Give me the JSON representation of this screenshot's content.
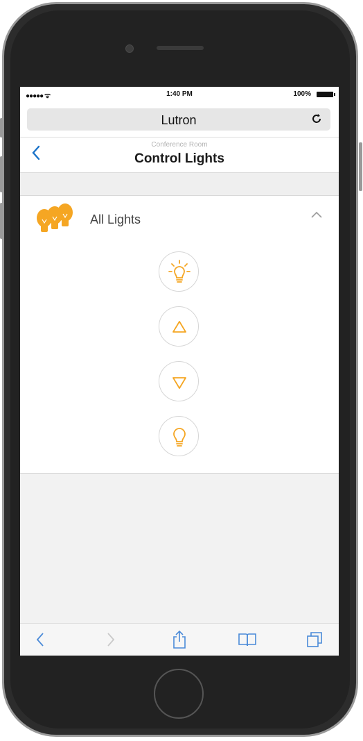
{
  "status_bar": {
    "signal": "●●●●● ᯤ",
    "time": "1:40 PM",
    "battery": "100%"
  },
  "browser": {
    "url_title": "Lutron"
  },
  "nav": {
    "subtitle": "Conference Room",
    "title": "Control Lights"
  },
  "group": {
    "label": "All Lights"
  },
  "colors": {
    "accent": "#f5a623",
    "back_link": "#1a73c9"
  }
}
